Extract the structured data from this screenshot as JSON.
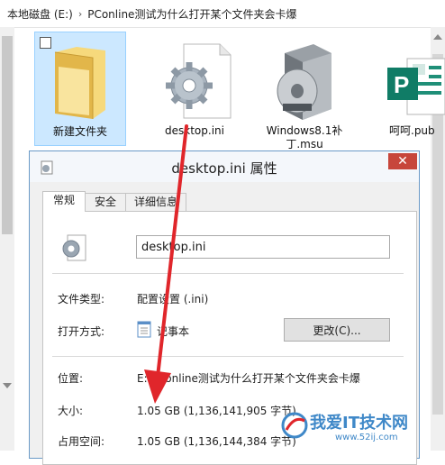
{
  "breadcrumb": {
    "items": [
      "本地磁盘 (E:)",
      "PConline测试为什么打开某个文件夹会卡爆"
    ],
    "separator": "›"
  },
  "files": [
    {
      "label": "新建文件夹",
      "icon": "folder-icon",
      "selected": true
    },
    {
      "label": "desktop.ini",
      "icon": "settings-gear-file-icon",
      "selected": false
    },
    {
      "label": "Windows8.1补丁.msu",
      "icon": "installer-box-icon",
      "selected": false
    },
    {
      "label": "呵呵.pub",
      "icon": "publisher-file-icon",
      "selected": false
    }
  ],
  "dialog": {
    "title": "desktop.ini 属性",
    "close_glyph": "✕",
    "tabs": [
      "常规",
      "安全",
      "详细信息"
    ],
    "active_tab": "常规",
    "file_name": "desktop.ini",
    "fields": {
      "type_label": "文件类型:",
      "type_value": "配置设置 (.ini)",
      "open_label": "打开方式:",
      "open_value": "记事本",
      "change_button": "更改(C)...",
      "location_label": "位置:",
      "location_value": "E:\\PConline测试为什么打开某个文件夹会卡爆",
      "size_label": "大小:",
      "size_value": "1.05 GB (1,136,141,905 字节)",
      "disk_label": "占用空间:",
      "disk_value": "1.05 GB (1,136,144,384 字节)"
    }
  },
  "watermark": {
    "main": "我爱IT技术网",
    "sub": "www.52ij.com"
  },
  "colors": {
    "selection": "#cce8ff",
    "close": "#c7463b",
    "arrow": "#e0262b",
    "watermark": "#3f88c8"
  }
}
